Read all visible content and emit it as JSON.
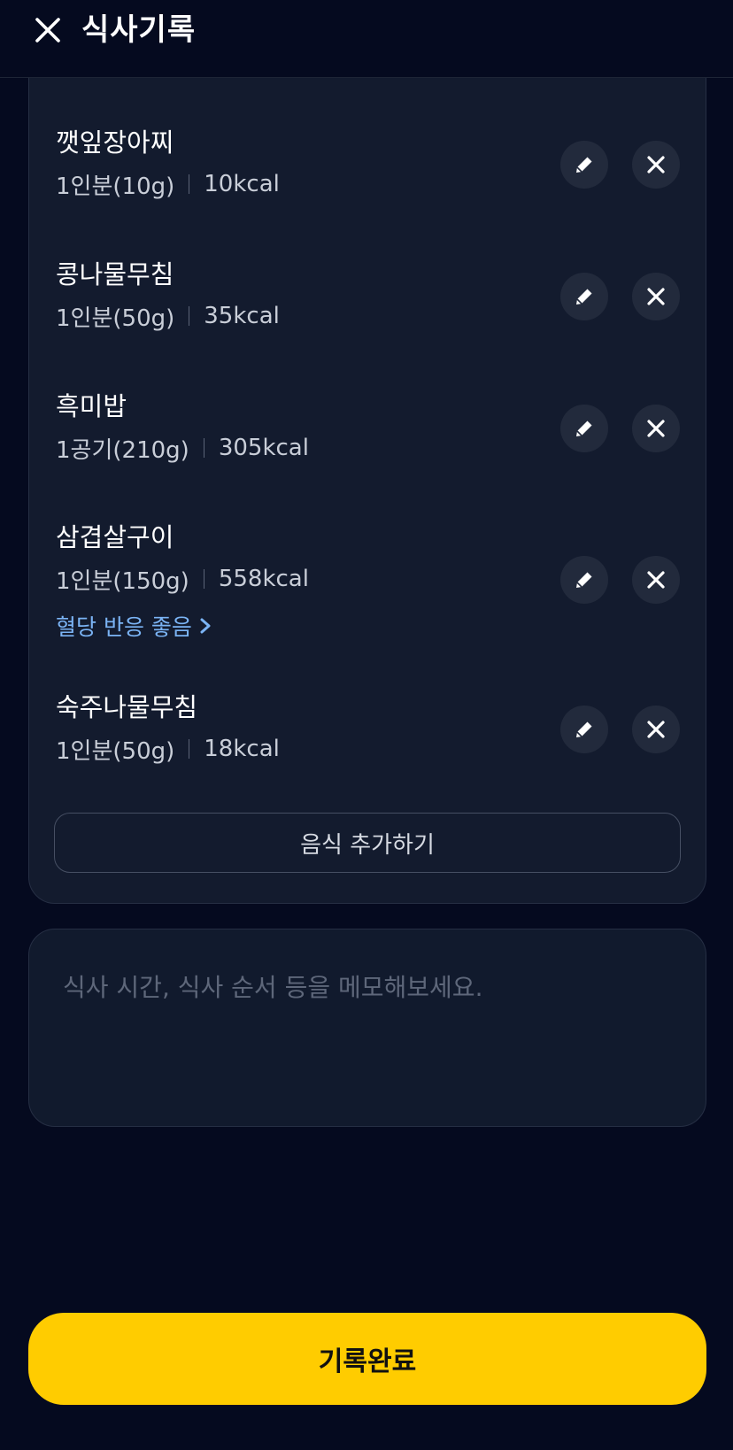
{
  "header": {
    "title": "식사기록",
    "close_icon": "close-icon"
  },
  "foods": [
    {
      "name": "깻잎장아찌",
      "serving": "1인분(10g)",
      "calories": "10kcal"
    },
    {
      "name": "콩나물무침",
      "serving": "1인분(50g)",
      "calories": "35kcal"
    },
    {
      "name": "흑미밥",
      "serving": "1공기(210g)",
      "calories": "305kcal"
    },
    {
      "name": "삼겹살구이",
      "serving": "1인분(150g)",
      "calories": "558kcal",
      "reaction": "혈당 반응 좋음"
    },
    {
      "name": "숙주나물무침",
      "serving": "1인분(50g)",
      "calories": "18kcal"
    }
  ],
  "actions": {
    "edit_icon": "pencil-icon",
    "delete_icon": "close-icon"
  },
  "add_food_label": "음식 추가하기",
  "memo": {
    "placeholder": "식사 시간, 식사 순서 등을 메모해보세요."
  },
  "submit_label": "기록완료",
  "colors": {
    "background": "#050a1f",
    "card": "#131b2e",
    "accent": "#ffcc00",
    "link": "#7bb4f5"
  }
}
